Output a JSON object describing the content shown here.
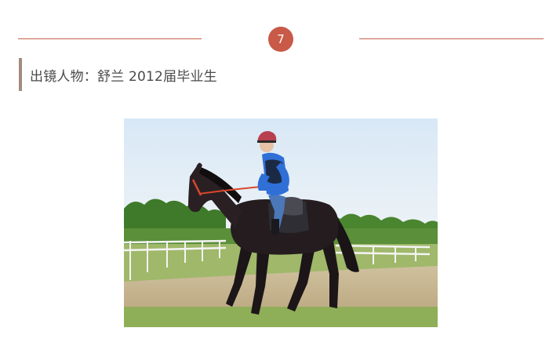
{
  "section": {
    "number": "7",
    "caption": "出镜人物：舒兰 2012届毕业生"
  },
  "colors": {
    "accent": "#c85a47",
    "caption_bar": "#a38b80",
    "caption_text": "#4a4a4a"
  },
  "photo": {
    "subject": "rider-on-dark-horse-icon"
  }
}
